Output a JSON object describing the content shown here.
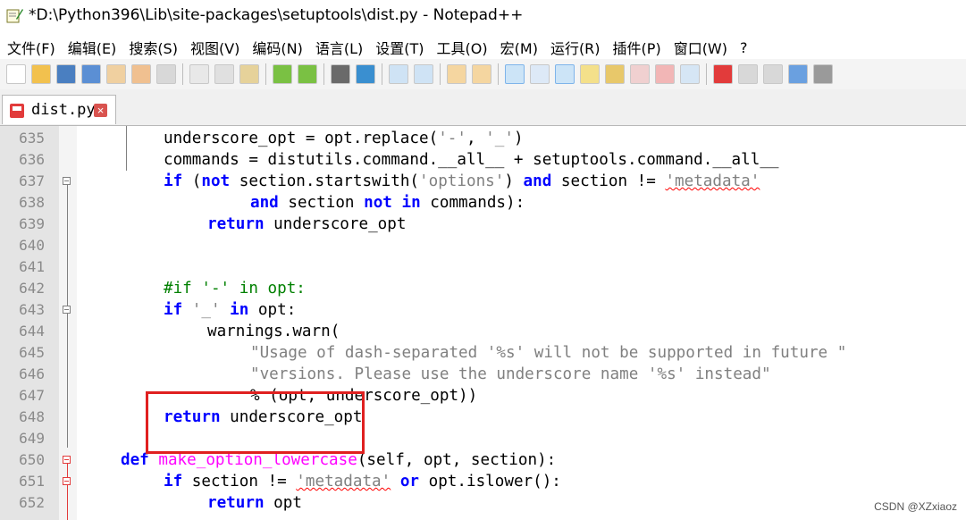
{
  "window": {
    "title": "*D:\\Python396\\Lib\\site-packages\\setuptools\\dist.py - Notepad++"
  },
  "menu": [
    "文件(F)",
    "编辑(E)",
    "搜索(S)",
    "视图(V)",
    "编码(N)",
    "语言(L)",
    "设置(T)",
    "工具(O)",
    "宏(M)",
    "运行(R)",
    "插件(P)",
    "窗口(W)",
    "?"
  ],
  "tab": {
    "label": "dist.py",
    "close": "×"
  },
  "line_numbers": [
    "635",
    "636",
    "637",
    "638",
    "639",
    "640",
    "641",
    "642",
    "643",
    "644",
    "645",
    "646",
    "647",
    "648",
    "649",
    "650",
    "651",
    "652"
  ],
  "code": {
    "l635": {
      "a": "underscore_opt = opt.replace(",
      "s1": "'-'",
      "b": ", ",
      "s2": "'_'",
      "c": ")"
    },
    "l636": {
      "a": "commands = distutils.command.__all__ + setuptools.command.__all__"
    },
    "l637": {
      "kw1": "if",
      "a": " (",
      "kw2": "not",
      "b": " section.startswith(",
      "s1": "'options'",
      "c": ") ",
      "kw3": "and",
      "d": " section != ",
      "s2": "'metadata'"
    },
    "l638": {
      "kw1": "and",
      "a": " section ",
      "kw2": "not in",
      "b": " commands):"
    },
    "l639": {
      "kw1": "return",
      "a": " underscore_opt"
    },
    "l642": {
      "cm": "#if '-' in opt:"
    },
    "l643": {
      "kw1": "if",
      "s1": " '_' ",
      "kw2": "in",
      "a": " opt:"
    },
    "l644": {
      "a": "warnings.warn("
    },
    "l645": {
      "s1": "\"Usage of dash-separated '%s' will not be supported in future \""
    },
    "l646": {
      "s1": "\"versions. Please use the underscore name '%s' instead\""
    },
    "l647": {
      "a": "% (opt, underscore_opt))"
    },
    "l648": {
      "kw1": "return",
      "a": " underscore_opt"
    },
    "l650": {
      "kw1": "def",
      "fn": " make_option_lowercase",
      "a": "(self, opt, section):"
    },
    "l651": {
      "kw1": "if",
      "a": " section != ",
      "s1": "'metadata'",
      "kw2": " or",
      "b": " opt.islower():"
    },
    "l652": {
      "kw1": "return",
      "a": " opt"
    }
  },
  "watermark": "CSDN @XZxiaoz",
  "colors": {
    "keyword": "#0000ff",
    "string": "#808080",
    "comment": "#008000",
    "function": "#ff00ff",
    "highlight_box": "#e02020"
  }
}
